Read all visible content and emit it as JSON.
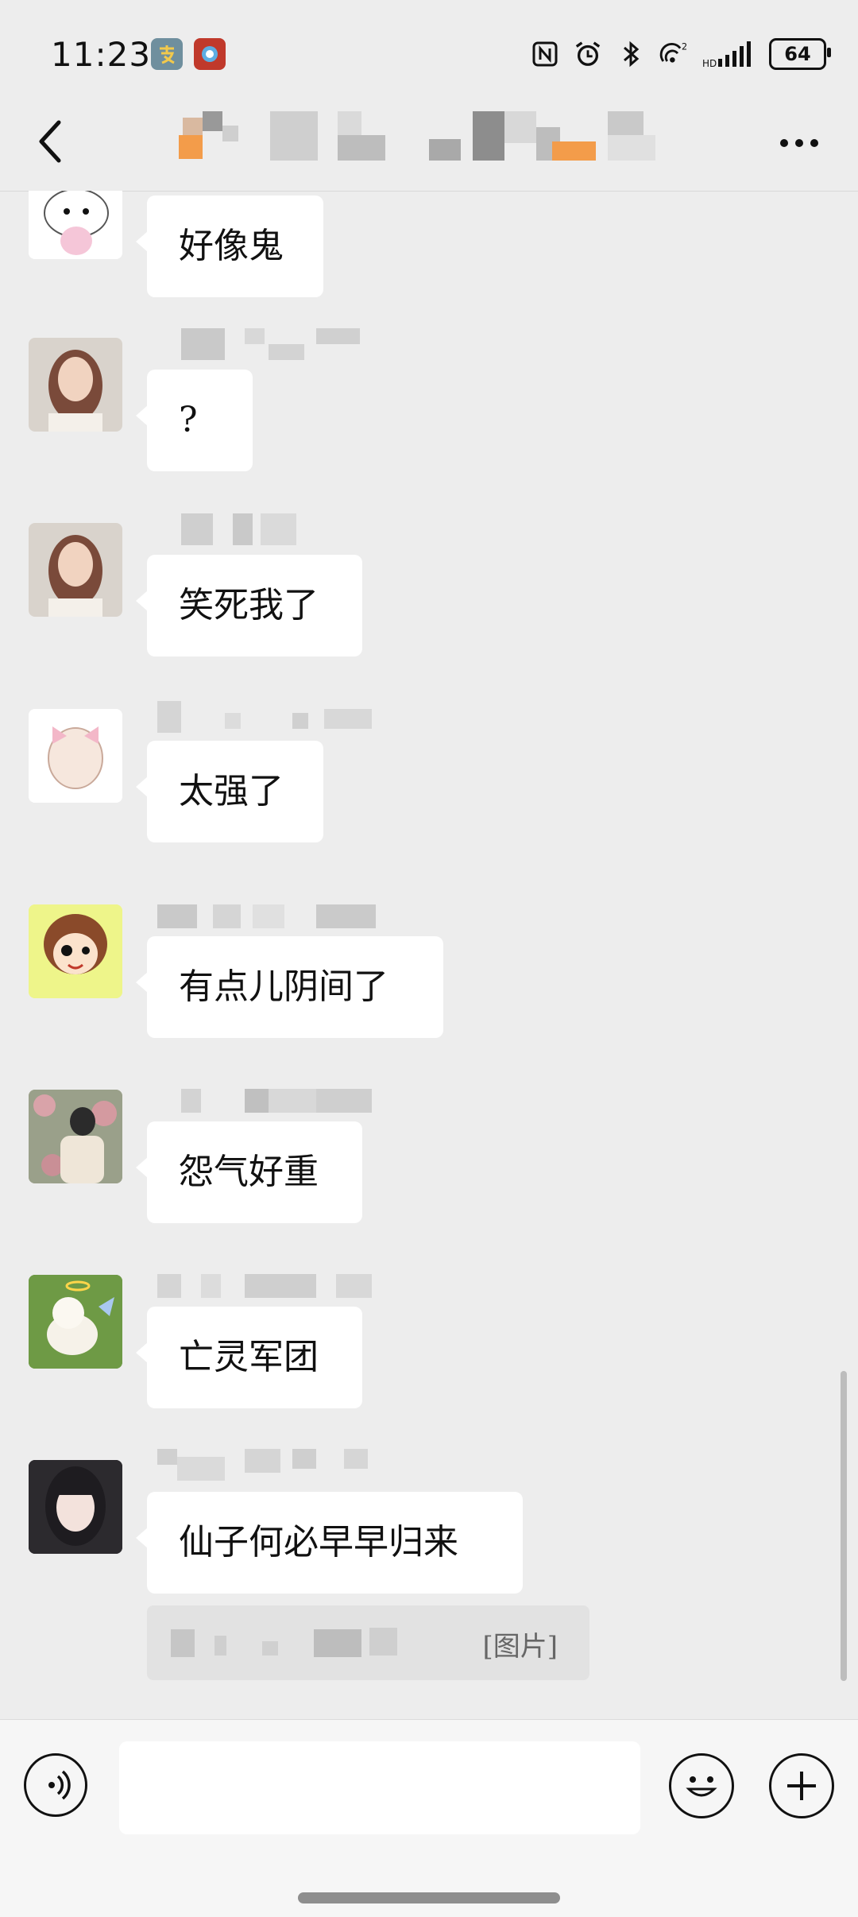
{
  "status_bar": {
    "time": "11:23",
    "battery": "64",
    "icons": [
      "alipay-icon",
      "app-icon",
      "nfc-icon",
      "alarm-icon",
      "bluetooth-icon",
      "hotspot-icon",
      "signal-icon"
    ]
  },
  "header": {
    "title": "",
    "icons": [
      "back-arrow-icon",
      "more-dots-icon"
    ]
  },
  "messages": [
    {
      "text": "好像鬼"
    },
    {
      "text": "?"
    },
    {
      "text": "笑死我了"
    },
    {
      "text": "太强了"
    },
    {
      "text": "有点儿阴间了"
    },
    {
      "text": "怨气好重"
    },
    {
      "text": "亡灵军团"
    },
    {
      "text": "仙子何必早早归来"
    }
  ],
  "quote": {
    "text": "[图片]"
  },
  "input_bar": {
    "placeholder": "",
    "icons": [
      "voice-icon",
      "emoji-icon",
      "plus-icon"
    ]
  },
  "colors": {
    "background": "#ededed",
    "bubble": "#ffffff",
    "input_bar": "#f6f6f6"
  }
}
